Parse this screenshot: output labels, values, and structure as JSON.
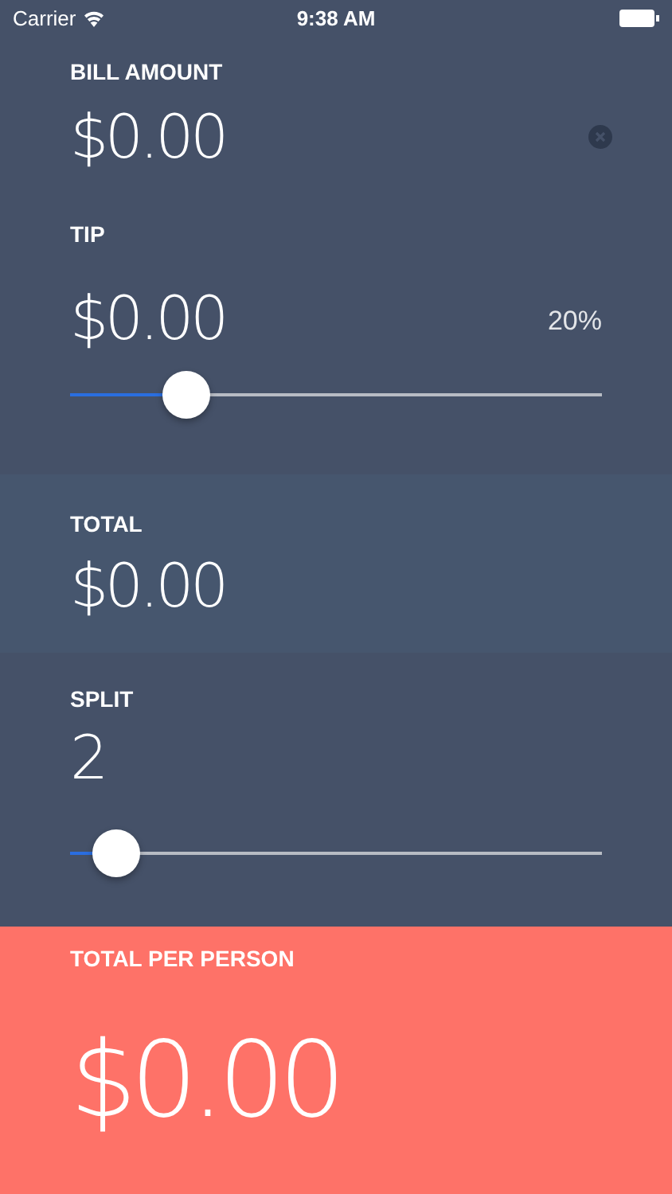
{
  "status_bar": {
    "carrier": "Carrier",
    "time": "9:38 AM"
  },
  "bill": {
    "label": "BILL AMOUNT",
    "value": "$0.00"
  },
  "tip": {
    "label": "TIP",
    "value": "$0.00",
    "percent": "20%",
    "level": 0.22
  },
  "total": {
    "label": "TOTAL",
    "value": "$0.00"
  },
  "split": {
    "label": "SPLIT",
    "value": "2",
    "level": 0.087
  },
  "per_person": {
    "label": "TOTAL PER PERSON",
    "value": "$0.00"
  }
}
